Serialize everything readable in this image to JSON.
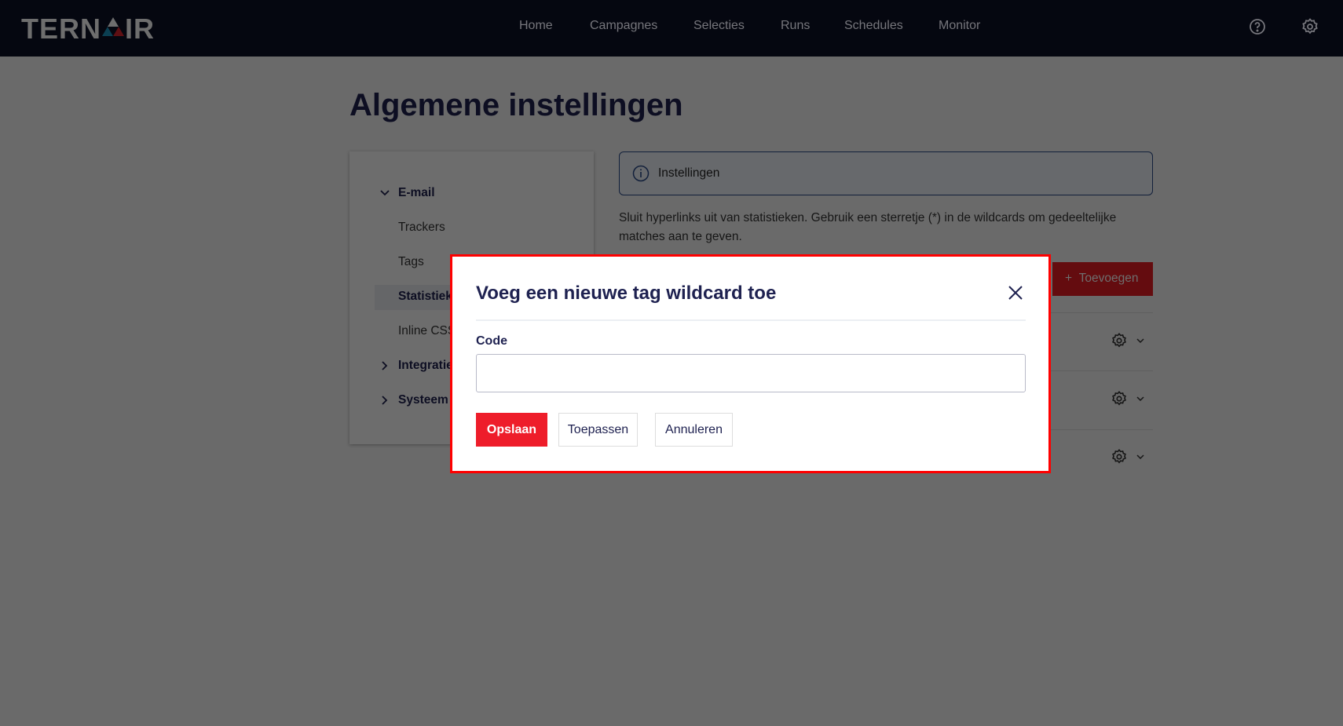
{
  "brand": {
    "logo": "TERNAIR"
  },
  "nav": {
    "items": [
      "Home",
      "Campagnes",
      "Selecties",
      "Runs",
      "Schedules",
      "Monitor"
    ]
  },
  "page": {
    "title": "Algemene instellingen"
  },
  "sidebar": {
    "email": "E-mail",
    "trackers": "Trackers",
    "tags": "Tags",
    "statistieken": "Statistieken",
    "inline_css": "Inline CSS",
    "integraties": "Integraties",
    "systeem": "Systeem"
  },
  "main": {
    "info_label": "Instellingen",
    "description": "Sluit hyperlinks uit van statistieken. Gebruik een sterretje (*) in de wildcards om gedeeltelijke matches aan te geven.",
    "add_label": "Toevoegen"
  },
  "modal": {
    "title": "Voeg een nieuwe tag wildcard toe",
    "code_label": "Code",
    "code_value": "",
    "save": "Opslaan",
    "apply": "Toepassen",
    "cancel": "Annuleren"
  },
  "colors": {
    "nav": "#0c1025",
    "accent": "#ee1d2a",
    "text": "#1e2150"
  }
}
